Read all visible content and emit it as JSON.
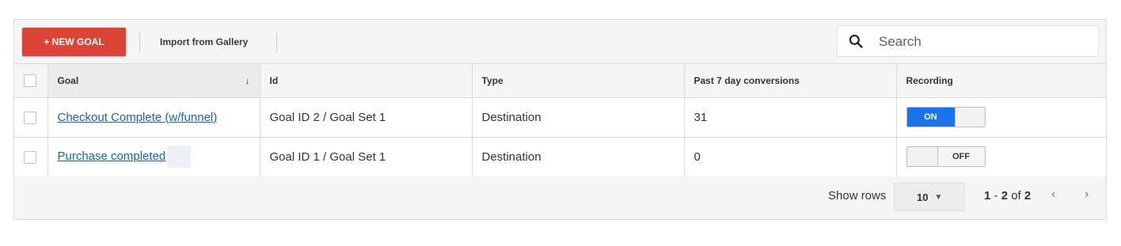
{
  "toolbar": {
    "new_goal_label": "+ NEW GOAL",
    "import_label": "Import from Gallery",
    "search": {
      "placeholder": "Search",
      "value": "",
      "icon": "search-icon"
    }
  },
  "table": {
    "columns": [
      "Goal",
      "Id",
      "Type",
      "Past 7 day conversions",
      "Recording"
    ],
    "sort_indicator": "↓",
    "rows": [
      {
        "goal": "Checkout Complete (w/funnel)",
        "id": "Goal ID 2 / Goal Set 1",
        "type": "Destination",
        "conversions": "31",
        "recording": "ON",
        "recording_on": true
      },
      {
        "goal": "Purchase completed",
        "id": "Goal ID 1 / Goal Set 1",
        "type": "Destination",
        "conversions": "0",
        "recording": "OFF",
        "recording_on": false
      }
    ]
  },
  "footer": {
    "show_rows_label": "Show rows",
    "rows_value": "10",
    "range_start": "1",
    "range_sep": " - ",
    "range_end": "2",
    "of_word": " of ",
    "total": "2",
    "prev_icon": "chevron-left-icon",
    "next_icon": "chevron-right-icon"
  },
  "colors": {
    "accent_red": "#db4437",
    "toggle_blue": "#1a73e8",
    "link_blue": "#1a5fc5"
  }
}
